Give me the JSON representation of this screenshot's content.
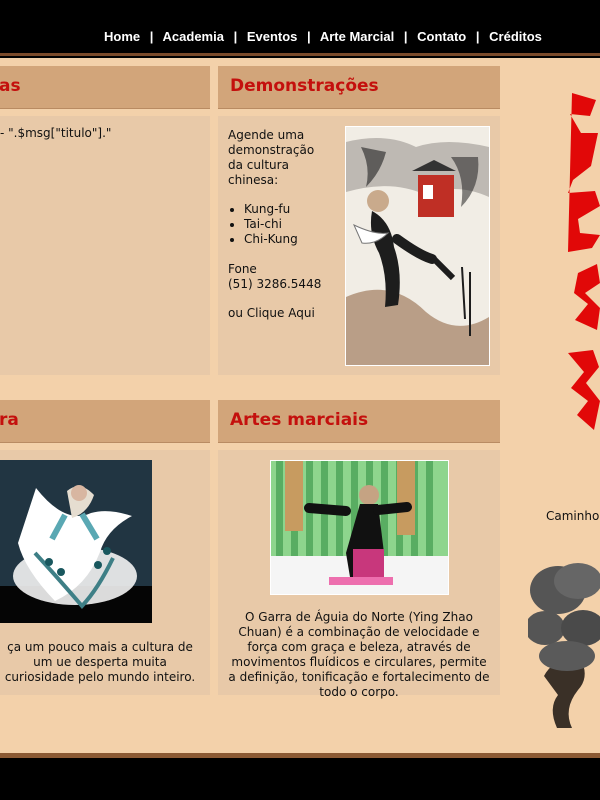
{
  "nav": {
    "items": [
      "Home",
      "Academia",
      "Eventos",
      "Arte Marcial",
      "Contato",
      "Créditos"
    ],
    "separator": "|"
  },
  "panels": {
    "left_top_title": "as",
    "left_top_body": "- \".$msg[\"titulo\"].\"",
    "demo_title": "Demonstrações",
    "demo_intro": "Agende uma demonstração da cultura chinesa:",
    "demo_list": [
      "Kung-fu",
      "Tai-chi",
      "Chi-Kung"
    ],
    "demo_phone_label": "Fone",
    "demo_phone": "(51) 3286.5448",
    "demo_link": "ou Clique Aqui",
    "left_bottom_title": "ra",
    "left_bottom_text": "ça um pouco mais a cultura de um ue desperta muita curiosidade pelo mundo inteiro.",
    "martial_title": "Artes marciais",
    "martial_text": "O Garra de Águia do Norte (Ying Zhao Chuan) é a combinação de velocidade e força com graça e beleza, através de movimentos fluídicos e circulares, permite a definição, tonificação e fortalecimento de todo o corpo."
  },
  "right": {
    "caption": "Caminho d"
  },
  "colors": {
    "background": "#f3d1aa",
    "panel_header": "#d2a57a",
    "panel_body": "#e8c9a8",
    "title_red": "#c4100d",
    "nav_bg": "#000000"
  }
}
